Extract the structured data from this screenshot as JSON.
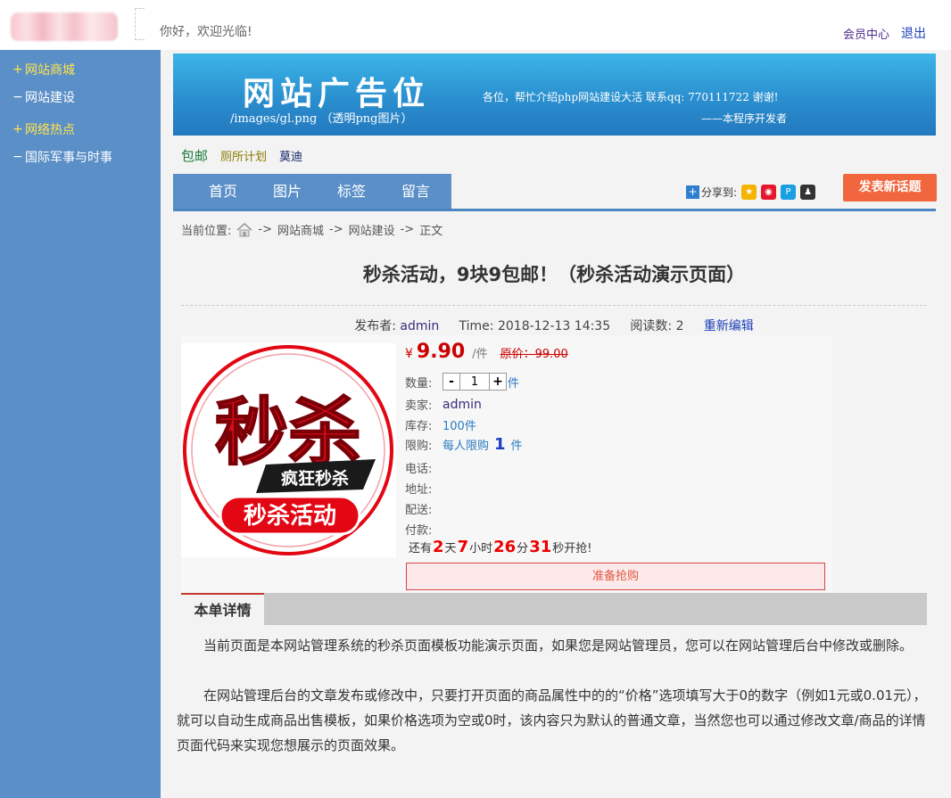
{
  "header": {
    "welcome": "你好，欢迎光临!",
    "member_center": "会员中心",
    "logout": "退出"
  },
  "sidebar": {
    "items": [
      {
        "symbol": "+",
        "label": "网站商城",
        "highlight": true
      },
      {
        "symbol": "−",
        "label": "网站建设",
        "highlight": false
      },
      {
        "symbol": "+",
        "label": "网络热点",
        "highlight": true
      },
      {
        "symbol": "−",
        "label": "国际军事与时事",
        "highlight": false
      }
    ]
  },
  "banner": {
    "title": "网站广告位",
    "path": "/images/gl.png  （透明png图片）",
    "notice": "各位，帮忙介绍php网站建设大活  联系qq: 770111722 谢谢!",
    "developer": "——本程序开发者"
  },
  "quicklinks": [
    "包邮",
    "厕所计划",
    "莫迪"
  ],
  "nav": {
    "items": [
      "首页",
      "图片",
      "标签",
      "留言"
    ],
    "share_label": "分享到:",
    "share_icons": [
      "qzone-icon",
      "weibo-icon",
      "qqweibo-icon",
      "qq-icon"
    ],
    "post_button": "发表新话题"
  },
  "breadcrumb": {
    "prefix": "当前位置:",
    "sep1": "->",
    "crumb1": "网站商城",
    "sep2": "->",
    "crumb2": "网站建设",
    "sep3": "->",
    "crumb3": "正文"
  },
  "article": {
    "title": "秒杀活动，9块9包邮！（秒杀活动演示页面）",
    "publisher_label": "发布者:",
    "publisher": "admin",
    "time_label": "Time:",
    "time": "2018-12-13 14:35",
    "reads_label": "阅读数:",
    "reads": "2",
    "edit": "重新编辑"
  },
  "product": {
    "image_big_text": "秒杀",
    "image_badge": "疯狂秒杀",
    "image_banner": "秒杀活动",
    "currency": "¥",
    "price": "9.90",
    "unit": "/件",
    "original_price": "原价：99.00",
    "qty_label": "数量:",
    "qty_minus": "-",
    "qty_value": "1",
    "qty_plus": "+",
    "qty_unit": "件",
    "seller_label": "卖家:",
    "seller": "admin",
    "stock_label": "库存:",
    "stock": "100件",
    "limit_label": "限购:",
    "limit_prefix": "每人限购",
    "limit_value": "1",
    "limit_unit": "件",
    "phone_label": "电话:",
    "address_label": "地址:",
    "shipping_label": "配送:",
    "payment_label": "付款:",
    "countdown": {
      "prefix": "还有",
      "days": "2",
      "days_unit": "天",
      "hours": "7",
      "hours_unit": "小时",
      "minutes": "26",
      "minutes_unit": "分",
      "seconds": "31",
      "suffix": "秒开抢!"
    },
    "buy_button": "准备抢购"
  },
  "detail": {
    "tab": "本单详情",
    "paragraphs": [
      "当前页面是本网站管理系统的秒杀页面模板功能演示页面，如果您是网站管理员，您可以在网站管理后台中修改或删除。",
      "在网站管理后台的文章发布或修改中，只要打开页面的商品属性中的的“价格”选项填写大于0的数字（例如1元或0.01元），就可以自动生成商品出售模板，如果价格选项为空或0时，该内容只为默认的普通文章，当然您也可以通过修改文章/商品的详情页面代码来实现您想展示的页面效果。"
    ]
  },
  "colors": {
    "sidebar_bg": "#5b8fc8",
    "nav_bg": "#5a8fc7",
    "accent_red": "#cc0000",
    "post_button": "#f2663d"
  }
}
